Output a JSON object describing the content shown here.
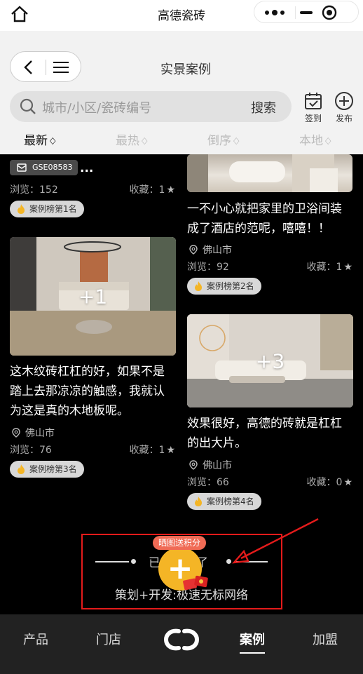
{
  "window": {
    "title": "高德瓷砖"
  },
  "header": {
    "page_title": "实景案例",
    "search_placeholder": "城市/小区/瓷砖编号",
    "search_button": "搜索",
    "checkin_label": "签到",
    "publish_label": "发布"
  },
  "filters": [
    {
      "label": "最新",
      "active": true
    },
    {
      "label": "最热",
      "active": false
    },
    {
      "label": "倒序",
      "active": false
    },
    {
      "label": "本地",
      "active": false
    }
  ],
  "cards": [
    {
      "id_tag": "GSE08583",
      "title_tail": "...",
      "views": "浏览：152",
      "favs": "收藏：1",
      "rank": "案例榜第1名"
    },
    {
      "title": "一不小心就把家里的卫浴间装成了酒店的范呢，嘻嘻！！",
      "location": "佛山市",
      "views": "浏览：92",
      "favs": "收藏：1",
      "rank": "案例榜第2名"
    },
    {
      "image_overlay": "+1",
      "title": "这木纹砖杠杠的好，如果不是踏上去那凉凉的触感，我就认为这是真的木地板呢。",
      "location": "佛山市",
      "views": "浏览：76",
      "favs": "收藏：1",
      "rank": "案例榜第3名"
    },
    {
      "image_overlay": "+3",
      "title": "效果很好，高德的砖就是杠杠的出大片。",
      "location": "佛山市",
      "views": "浏览：66",
      "favs": "收藏：0",
      "rank": "案例榜第4名"
    }
  ],
  "footer": {
    "end_text": "已经到底了",
    "credit": "策划+开发:极速无标网络",
    "fab_badge": "晒图送积分",
    "fab_symbol": "+"
  },
  "tabbar": [
    {
      "label": "产品",
      "active": false
    },
    {
      "label": "门店",
      "active": false
    },
    {
      "label": "案例",
      "active": true
    },
    {
      "label": "加盟",
      "active": false
    }
  ],
  "colors": {
    "accent_yellow": "#f4b526",
    "badge_red": "#f06b55",
    "annotation_red": "#e41b1b",
    "background": "#000000"
  }
}
